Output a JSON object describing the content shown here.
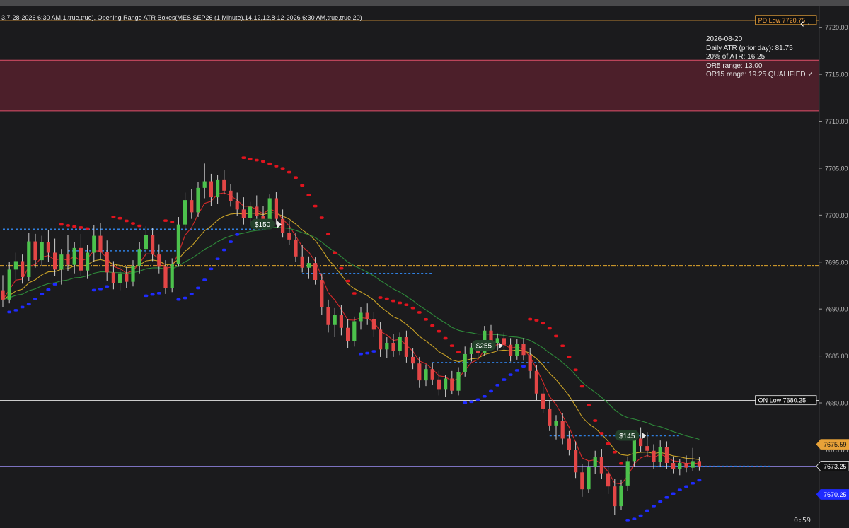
{
  "indicator_header": "3,7-28-2026 6:30 AM,1,true,true), Opening Range ATR Boxes(MES SEP26 (1 Minute),14,12,12,8-12-2026 6:30 AM,true,true,20)",
  "info_panel": {
    "date": "2026-08-20",
    "daily_atr": "Daily ATR (prior day): 81.75",
    "atr_pct": "20% of ATR: 16.25",
    "or5": "OR5 range: 13.00",
    "or15": "OR15 range: 19.25  QUALIFIED ✓"
  },
  "timer": "0:59",
  "icons": {
    "back": "back-arrow-icon"
  },
  "colors": {
    "background": "#1b1b1d",
    "bull": "#4cc24c",
    "bear": "#e34646",
    "psar_red": "#e0141e",
    "psar_blue": "#1f2bff",
    "ema_fast": "#d42a2a",
    "ema_slow": "#c9a227",
    "ema_long": "#2e8a3a",
    "pdlow": "#e8a238",
    "onlow": "#e6e6e6",
    "last": "#8a7fd8",
    "mid_level": "#e0a52c",
    "zone_fill": "#4c1f2a",
    "zone_border": "#e0506a",
    "or_level": "#2f7fe0"
  },
  "chart_data": {
    "type": "candlestick",
    "instrument": "MES SEP26 (1 Minute)",
    "ylim": [
      7665,
      7723.5
    ],
    "y_ticks": [
      "7720.00",
      "7715.00",
      "7710.00",
      "7705.00",
      "7700.00",
      "7695.00",
      "7690.00",
      "7685.00",
      "7680.00",
      "7675.00"
    ],
    "levels": [
      {
        "label": "PD Low 7720.75",
        "value": 7720.75,
        "color": "#e8a238"
      },
      {
        "label": "ON Low 7680.25",
        "value": 7680.25,
        "color": "#e6e6e6"
      }
    ],
    "zone": {
      "low": 7711.1,
      "high": 7716.5
    },
    "midline": 7694.6,
    "price_tags": [
      {
        "label": "7675.59",
        "value": 7675.59,
        "bg": "#e8a238",
        "fg": "#111111"
      },
      {
        "label": "7673.25",
        "value": 7673.25,
        "bg": "#111111",
        "fg": "#ffffff"
      },
      {
        "label": "7670.25",
        "value": 7670.25,
        "bg": "#1f2bff",
        "fg": "#ffffff"
      }
    ],
    "trade_labels": [
      {
        "label": "$150",
        "index": 40,
        "value": 7699.0
      },
      {
        "label": "$255",
        "index": 74,
        "value": 7686.1
      },
      {
        "label": "$145",
        "index": 96,
        "value": 7676.5
      }
    ],
    "or_levels": [
      {
        "from": 0,
        "to": 40,
        "value": 7698.5
      },
      {
        "from": 10,
        "to": 27,
        "value": 7696.2
      },
      {
        "from": 46,
        "to": 66,
        "value": 7693.8
      },
      {
        "from": 66,
        "to": 84,
        "value": 7684.3
      },
      {
        "from": 84,
        "to": 104,
        "value": 7676.5
      },
      {
        "from": 100,
        "to": 118,
        "value": 7673.25
      }
    ],
    "candles": [
      {
        "o": 7692.0,
        "h": 7693.6,
        "l": 7690.2,
        "c": 7691.0
      },
      {
        "o": 7691.0,
        "h": 7695.0,
        "l": 7690.6,
        "c": 7694.2
      },
      {
        "o": 7694.2,
        "h": 7696.0,
        "l": 7693.0,
        "c": 7695.1
      },
      {
        "o": 7695.1,
        "h": 7695.8,
        "l": 7692.7,
        "c": 7693.4
      },
      {
        "o": 7693.4,
        "h": 7698.1,
        "l": 7693.0,
        "c": 7697.2
      },
      {
        "o": 7697.2,
        "h": 7698.0,
        "l": 7694.4,
        "c": 7695.2
      },
      {
        "o": 7695.2,
        "h": 7697.8,
        "l": 7694.6,
        "c": 7697.1
      },
      {
        "o": 7697.1,
        "h": 7698.4,
        "l": 7695.0,
        "c": 7696.0
      },
      {
        "o": 7696.0,
        "h": 7697.5,
        "l": 7693.5,
        "c": 7694.2
      },
      {
        "o": 7694.2,
        "h": 7696.4,
        "l": 7692.6,
        "c": 7695.8
      },
      {
        "o": 7695.8,
        "h": 7697.9,
        "l": 7694.0,
        "c": 7694.7
      },
      {
        "o": 7694.7,
        "h": 7697.1,
        "l": 7693.8,
        "c": 7696.5
      },
      {
        "o": 7696.5,
        "h": 7698.0,
        "l": 7693.5,
        "c": 7694.1
      },
      {
        "o": 7694.1,
        "h": 7696.8,
        "l": 7693.2,
        "c": 7696.0
      },
      {
        "o": 7696.0,
        "h": 7698.9,
        "l": 7695.0,
        "c": 7697.8
      },
      {
        "o": 7697.8,
        "h": 7699.2,
        "l": 7695.3,
        "c": 7696.1
      },
      {
        "o": 7696.1,
        "h": 7697.3,
        "l": 7693.0,
        "c": 7693.9
      },
      {
        "o": 7693.9,
        "h": 7695.1,
        "l": 7692.1,
        "c": 7692.8
      },
      {
        "o": 7692.8,
        "h": 7694.6,
        "l": 7692.0,
        "c": 7693.8
      },
      {
        "o": 7693.8,
        "h": 7694.5,
        "l": 7692.2,
        "c": 7692.9
      },
      {
        "o": 7692.9,
        "h": 7695.2,
        "l": 7692.4,
        "c": 7694.6
      },
      {
        "o": 7694.6,
        "h": 7697.1,
        "l": 7693.8,
        "c": 7696.4
      },
      {
        "o": 7696.4,
        "h": 7698.8,
        "l": 7695.6,
        "c": 7697.9
      },
      {
        "o": 7697.9,
        "h": 7698.6,
        "l": 7695.1,
        "c": 7695.8
      },
      {
        "o": 7695.8,
        "h": 7696.9,
        "l": 7693.8,
        "c": 7694.5
      },
      {
        "o": 7694.5,
        "h": 7695.2,
        "l": 7691.6,
        "c": 7692.2
      },
      {
        "o": 7692.2,
        "h": 7695.4,
        "l": 7691.8,
        "c": 7694.8
      },
      {
        "o": 7694.8,
        "h": 7699.8,
        "l": 7694.5,
        "c": 7699.0
      },
      {
        "o": 7699.0,
        "h": 7702.4,
        "l": 7698.3,
        "c": 7701.6
      },
      {
        "o": 7701.6,
        "h": 7702.8,
        "l": 7699.6,
        "c": 7700.3
      },
      {
        "o": 7700.3,
        "h": 7703.5,
        "l": 7699.8,
        "c": 7702.9
      },
      {
        "o": 7702.9,
        "h": 7705.5,
        "l": 7701.8,
        "c": 7703.6
      },
      {
        "o": 7703.6,
        "h": 7704.4,
        "l": 7701.0,
        "c": 7701.9
      },
      {
        "o": 7701.9,
        "h": 7704.3,
        "l": 7701.2,
        "c": 7703.8
      },
      {
        "o": 7703.8,
        "h": 7704.8,
        "l": 7702.2,
        "c": 7702.6
      },
      {
        "o": 7702.6,
        "h": 7703.3,
        "l": 7700.9,
        "c": 7701.5
      },
      {
        "o": 7701.5,
        "h": 7702.4,
        "l": 7699.9,
        "c": 7700.6
      },
      {
        "o": 7700.6,
        "h": 7701.9,
        "l": 7699.0,
        "c": 7699.7
      },
      {
        "o": 7699.7,
        "h": 7701.4,
        "l": 7699.0,
        "c": 7700.9
      },
      {
        "o": 7700.9,
        "h": 7702.1,
        "l": 7699.4,
        "c": 7699.9
      },
      {
        "o": 7699.9,
        "h": 7701.0,
        "l": 7698.6,
        "c": 7699.2
      },
      {
        "o": 7699.2,
        "h": 7702.2,
        "l": 7698.8,
        "c": 7701.8
      },
      {
        "o": 7701.8,
        "h": 7702.5,
        "l": 7699.0,
        "c": 7699.6
      },
      {
        "o": 7699.6,
        "h": 7700.6,
        "l": 7697.6,
        "c": 7698.1
      },
      {
        "o": 7698.1,
        "h": 7699.4,
        "l": 7696.8,
        "c": 7697.4
      },
      {
        "o": 7697.4,
        "h": 7698.1,
        "l": 7695.0,
        "c": 7695.6
      },
      {
        "o": 7695.6,
        "h": 7696.8,
        "l": 7693.9,
        "c": 7694.4
      },
      {
        "o": 7694.4,
        "h": 7695.6,
        "l": 7693.2,
        "c": 7694.9
      },
      {
        "o": 7694.9,
        "h": 7695.5,
        "l": 7692.6,
        "c": 7693.1
      },
      {
        "o": 7693.1,
        "h": 7693.8,
        "l": 7689.4,
        "c": 7690.2
      },
      {
        "o": 7690.2,
        "h": 7691.0,
        "l": 7687.5,
        "c": 7688.3
      },
      {
        "o": 7688.3,
        "h": 7690.1,
        "l": 7687.0,
        "c": 7689.4
      },
      {
        "o": 7689.4,
        "h": 7690.4,
        "l": 7687.2,
        "c": 7688.0
      },
      {
        "o": 7688.0,
        "h": 7688.9,
        "l": 7685.8,
        "c": 7686.6
      },
      {
        "o": 7686.6,
        "h": 7689.2,
        "l": 7686.0,
        "c": 7688.7
      },
      {
        "o": 7688.7,
        "h": 7690.2,
        "l": 7687.8,
        "c": 7689.6
      },
      {
        "o": 7689.6,
        "h": 7690.6,
        "l": 7688.3,
        "c": 7688.9
      },
      {
        "o": 7688.9,
        "h": 7689.7,
        "l": 7687.0,
        "c": 7687.8
      },
      {
        "o": 7687.8,
        "h": 7688.6,
        "l": 7684.9,
        "c": 7685.7
      },
      {
        "o": 7685.7,
        "h": 7687.0,
        "l": 7684.8,
        "c": 7686.4
      },
      {
        "o": 7686.4,
        "h": 7687.3,
        "l": 7684.9,
        "c": 7685.5
      },
      {
        "o": 7685.5,
        "h": 7687.5,
        "l": 7685.1,
        "c": 7687.0
      },
      {
        "o": 7687.0,
        "h": 7687.7,
        "l": 7684.3,
        "c": 7684.9
      },
      {
        "o": 7684.9,
        "h": 7685.8,
        "l": 7683.6,
        "c": 7684.2
      },
      {
        "o": 7684.2,
        "h": 7684.9,
        "l": 7681.6,
        "c": 7682.4
      },
      {
        "o": 7682.4,
        "h": 7684.1,
        "l": 7681.8,
        "c": 7683.6
      },
      {
        "o": 7683.6,
        "h": 7684.3,
        "l": 7681.9,
        "c": 7682.5
      },
      {
        "o": 7682.5,
        "h": 7683.4,
        "l": 7680.8,
        "c": 7681.4
      },
      {
        "o": 7681.4,
        "h": 7683.0,
        "l": 7680.6,
        "c": 7682.6
      },
      {
        "o": 7682.6,
        "h": 7683.4,
        "l": 7680.9,
        "c": 7681.3
      },
      {
        "o": 7681.3,
        "h": 7683.8,
        "l": 7680.8,
        "c": 7683.3
      },
      {
        "o": 7683.3,
        "h": 7686.0,
        "l": 7682.8,
        "c": 7685.2
      },
      {
        "o": 7685.2,
        "h": 7686.4,
        "l": 7684.4,
        "c": 7685.9
      },
      {
        "o": 7685.9,
        "h": 7686.7,
        "l": 7684.8,
        "c": 7685.3
      },
      {
        "o": 7685.3,
        "h": 7688.2,
        "l": 7685.0,
        "c": 7687.7
      },
      {
        "o": 7687.7,
        "h": 7688.3,
        "l": 7685.9,
        "c": 7686.4
      },
      {
        "o": 7686.4,
        "h": 7687.4,
        "l": 7685.6,
        "c": 7686.9
      },
      {
        "o": 7686.9,
        "h": 7687.5,
        "l": 7685.8,
        "c": 7686.2
      },
      {
        "o": 7686.2,
        "h": 7686.9,
        "l": 7684.4,
        "c": 7685.0
      },
      {
        "o": 7685.0,
        "h": 7686.8,
        "l": 7684.6,
        "c": 7686.3
      },
      {
        "o": 7686.3,
        "h": 7686.9,
        "l": 7684.5,
        "c": 7685.1
      },
      {
        "o": 7685.1,
        "h": 7685.8,
        "l": 7682.6,
        "c": 7683.4
      },
      {
        "o": 7683.4,
        "h": 7684.0,
        "l": 7680.3,
        "c": 7681.0
      },
      {
        "o": 7681.0,
        "h": 7681.8,
        "l": 7678.9,
        "c": 7679.4
      },
      {
        "o": 7679.4,
        "h": 7680.2,
        "l": 7677.0,
        "c": 7677.6
      },
      {
        "o": 7677.6,
        "h": 7678.7,
        "l": 7676.1,
        "c": 7678.1
      },
      {
        "o": 7678.1,
        "h": 7678.9,
        "l": 7675.6,
        "c": 7676.2
      },
      {
        "o": 7676.2,
        "h": 7677.0,
        "l": 7674.4,
        "c": 7675.0
      },
      {
        "o": 7675.0,
        "h": 7675.9,
        "l": 7672.0,
        "c": 7672.6
      },
      {
        "o": 7672.6,
        "h": 7673.5,
        "l": 7670.0,
        "c": 7670.8
      },
      {
        "o": 7670.8,
        "h": 7673.8,
        "l": 7670.4,
        "c": 7673.2
      },
      {
        "o": 7673.2,
        "h": 7674.9,
        "l": 7672.4,
        "c": 7674.2
      },
      {
        "o": 7674.2,
        "h": 7675.1,
        "l": 7671.9,
        "c": 7672.5
      },
      {
        "o": 7672.5,
        "h": 7673.3,
        "l": 7670.3,
        "c": 7671.1
      },
      {
        "o": 7671.1,
        "h": 7671.9,
        "l": 7668.1,
        "c": 7669.0
      },
      {
        "o": 7669.0,
        "h": 7671.8,
        "l": 7668.6,
        "c": 7671.2
      },
      {
        "o": 7671.2,
        "h": 7674.3,
        "l": 7670.6,
        "c": 7673.8
      },
      {
        "o": 7673.8,
        "h": 7677.0,
        "l": 7673.2,
        "c": 7676.2
      },
      {
        "o": 7676.2,
        "h": 7677.4,
        "l": 7674.8,
        "c": 7675.4
      },
      {
        "o": 7675.4,
        "h": 7676.9,
        "l": 7674.2,
        "c": 7674.9
      },
      {
        "o": 7674.9,
        "h": 7675.6,
        "l": 7673.0,
        "c": 7673.7
      },
      {
        "o": 7673.7,
        "h": 7676.0,
        "l": 7673.2,
        "c": 7675.3
      },
      {
        "o": 7675.3,
        "h": 7675.9,
        "l": 7673.0,
        "c": 7673.6
      },
      {
        "o": 7673.6,
        "h": 7674.3,
        "l": 7672.5,
        "c": 7673.0
      },
      {
        "o": 7673.0,
        "h": 7674.0,
        "l": 7672.3,
        "c": 7673.6
      },
      {
        "o": 7673.6,
        "h": 7674.4,
        "l": 7672.6,
        "c": 7673.1
      },
      {
        "o": 7673.1,
        "h": 7675.2,
        "l": 7672.7,
        "c": 7673.8
      },
      {
        "o": 7673.8,
        "h": 7674.2,
        "l": 7672.8,
        "c": 7673.25
      }
    ]
  }
}
